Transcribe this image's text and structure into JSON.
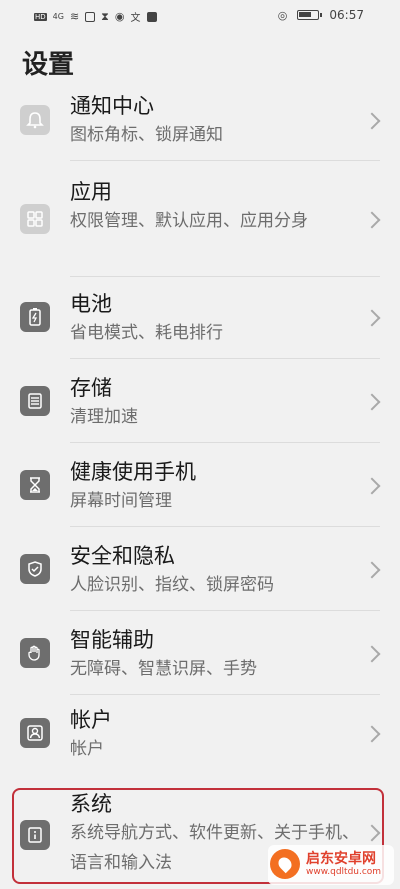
{
  "status_bar": {
    "left_labels": [
      "HD",
      "4G",
      "all"
    ],
    "time": "06:57",
    "icons": [
      "hd-icon",
      "signal-icon",
      "wifi-icon",
      "notification-icon",
      "hourglass-icon",
      "location-icon",
      "translate-icon",
      "photo-icon",
      "eye-icon",
      "battery-icon"
    ]
  },
  "title": "设置",
  "items": [
    {
      "name": "通知中心",
      "desc": "图标角标、锁屏通知",
      "icon": "bell-icon"
    },
    {
      "name": "应用",
      "desc": "权限管理、默认应用、应用分身",
      "icon": "apps-grid-icon"
    },
    {
      "name": "电池",
      "desc": "省电模式、耗电排行",
      "icon": "battery-settings-icon"
    },
    {
      "name": "存储",
      "desc": "清理加速",
      "icon": "storage-icon"
    },
    {
      "name": "健康使用手机",
      "desc": "屏幕时间管理",
      "icon": "hourglass-settings-icon"
    },
    {
      "name": "安全和隐私",
      "desc": "人脸识别、指纹、锁屏密码",
      "icon": "shield-icon"
    },
    {
      "name": "智能辅助",
      "desc": "无障碍、智慧识屏、手势",
      "icon": "hand-icon"
    },
    {
      "name": "帐户",
      "desc": "帐户",
      "icon": "account-icon"
    },
    {
      "name": "系统",
      "desc": "系统导航方式、软件更新、关于手机、语言和输入法",
      "icon": "system-info-icon"
    }
  ],
  "watermark": {
    "title": "启东安卓网",
    "url": "www.qdltdu.com"
  }
}
